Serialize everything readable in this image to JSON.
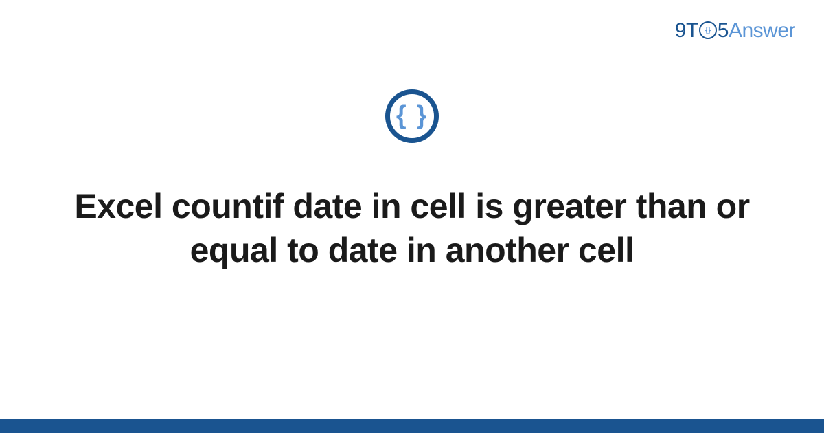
{
  "brand": {
    "part1": "9",
    "part2": "T",
    "part3": "5",
    "part4": "Answer"
  },
  "badge": {
    "symbol": "{ }"
  },
  "title": "Excel countif date in cell is greater than or equal to date in another cell",
  "colors": {
    "primary": "#1a5490",
    "accent": "#5b95d6"
  }
}
